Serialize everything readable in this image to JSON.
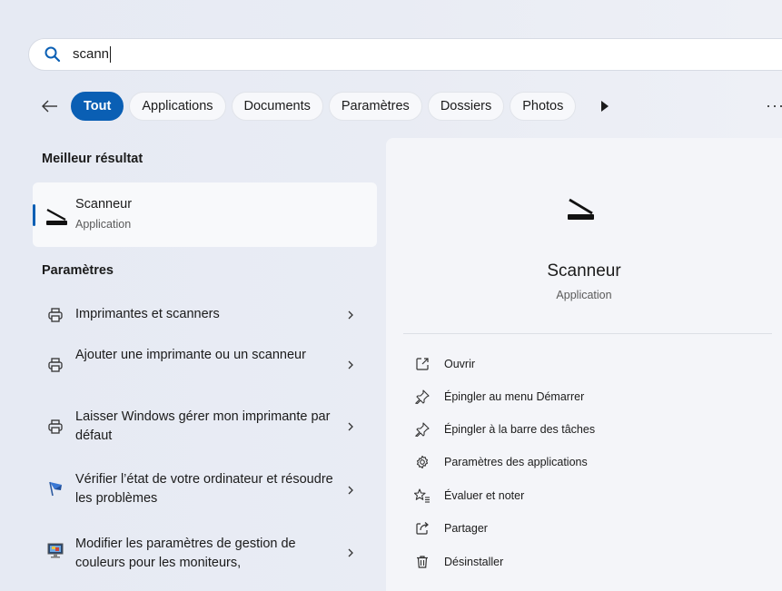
{
  "search": {
    "query": "scann"
  },
  "filters": {
    "chips": [
      "Tout",
      "Applications",
      "Documents",
      "Paramètres",
      "Dossiers",
      "Photos"
    ],
    "active": "Tout",
    "more_label": "···"
  },
  "best_match": {
    "heading": "Meilleur résultat",
    "title": "Scanneur",
    "subtitle": "Application"
  },
  "settings": {
    "heading": "Paramètres",
    "items": [
      {
        "label": "Imprimantes et scanners",
        "icon": "printer-icon"
      },
      {
        "label": "Ajouter une imprimante ou un scanneur",
        "icon": "printer-icon"
      },
      {
        "label": "Laisser Windows gérer mon imprimante par défaut",
        "icon": "printer-icon"
      },
      {
        "label": "Vérifier l’état de votre ordinateur et résoudre les problèmes",
        "icon": "flag-icon"
      },
      {
        "label": "Modifier les paramètres de gestion de couleurs pour les moniteurs,",
        "icon": "monitor-icon"
      }
    ]
  },
  "detail": {
    "title": "Scanneur",
    "subtitle": "Application",
    "actions": [
      {
        "label": "Ouvrir",
        "icon": "open-external-icon"
      },
      {
        "label": "Épingler au menu Démarrer",
        "icon": "pin-icon"
      },
      {
        "label": "Épingler à la barre des tâches",
        "icon": "pin-icon"
      },
      {
        "label": "Paramètres des applications",
        "icon": "gear-icon"
      },
      {
        "label": "Évaluer et noter",
        "icon": "star-icon"
      },
      {
        "label": "Partager",
        "icon": "share-icon"
      },
      {
        "label": "Désinstaller",
        "icon": "trash-icon"
      }
    ]
  },
  "colors": {
    "accent": "#0a5fb4",
    "panel": "#f4f5f9",
    "card": "#f8f9fb"
  }
}
